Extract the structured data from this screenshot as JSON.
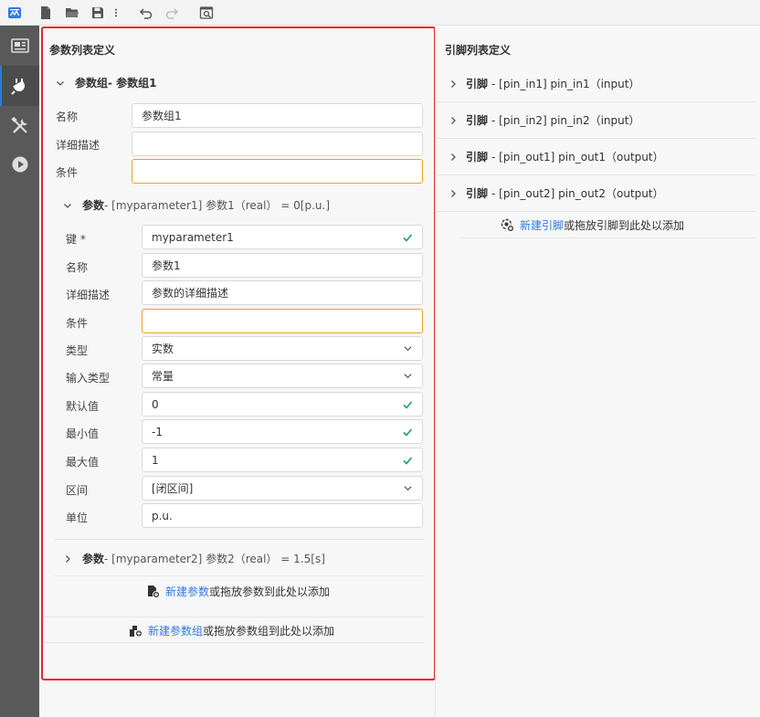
{
  "toolbar": {
    "icons": [
      "app-logo-icon",
      "new-file-icon",
      "open-folder-icon",
      "save-icon",
      "more-icon",
      "undo-icon",
      "redo-icon",
      "search-preview-icon"
    ]
  },
  "sidebar": {
    "items": [
      "layout-icon",
      "plug-icon",
      "tools-icon",
      "play-icon"
    ],
    "active": 1
  },
  "param_panel": {
    "title": "参数列表定义",
    "group": {
      "header_prefix": "参数组",
      "header_rest": " - 参数组1",
      "fields": [
        {
          "label": "名称",
          "value": ""
        },
        {
          "label": "详细描述",
          "value": ""
        },
        {
          "label": "条件",
          "value": ""
        }
      ],
      "name_value": "参数组1"
    },
    "param1": {
      "header_prefix": "参数",
      "header_rest": " - [myparameter1] 参数1（real） = 0[p.u.]",
      "fields": [
        {
          "label": "键 *",
          "value": "myparameter1",
          "check": true
        },
        {
          "label": "名称",
          "value": "参数1"
        },
        {
          "label": "详细描述",
          "value": "参数的详细描述"
        },
        {
          "label": "条件",
          "value": ""
        },
        {
          "label": "类型",
          "value": "实数",
          "select": true
        },
        {
          "label": "输入类型",
          "value": "常量",
          "select": true
        },
        {
          "label": "默认值",
          "value": "0",
          "check": true
        },
        {
          "label": "最小值",
          "value": "-1",
          "check": true
        },
        {
          "label": "最大值",
          "value": "1",
          "check": true
        },
        {
          "label": "区间",
          "value": "[闭区间]",
          "select": true
        },
        {
          "label": "单位",
          "value": "p.u."
        }
      ]
    },
    "param2": {
      "header_prefix": "参数",
      "header_rest": " - [myparameter2] 参数2（real） = 1.5[s]"
    },
    "add_param": {
      "link": "新建参数",
      "rest": "或拖放参数到此处以添加"
    },
    "add_group": {
      "link": "新建参数组",
      "rest": "或拖放参数组到此处以添加"
    }
  },
  "pin_panel": {
    "title": "引脚列表定义",
    "pins": [
      {
        "prefix": "引脚",
        "rest": "- [pin_in1] pin_in1（input）"
      },
      {
        "prefix": "引脚",
        "rest": "- [pin_in2] pin_in2（input）"
      },
      {
        "prefix": "引脚",
        "rest": "- [pin_out1] pin_out1（output）"
      },
      {
        "prefix": "引脚",
        "rest": "- [pin_out2] pin_out2（output）"
      }
    ],
    "add_pin": {
      "link": "新建引脚",
      "rest": "或拖放引脚到此处以添加"
    }
  },
  "colors": {
    "accent": "#2f7be0",
    "highlight_frame": "#e8262b",
    "warning_border": "#f0a020",
    "valid_check": "#1a9b7a",
    "sidebar_bg": "#595959"
  }
}
